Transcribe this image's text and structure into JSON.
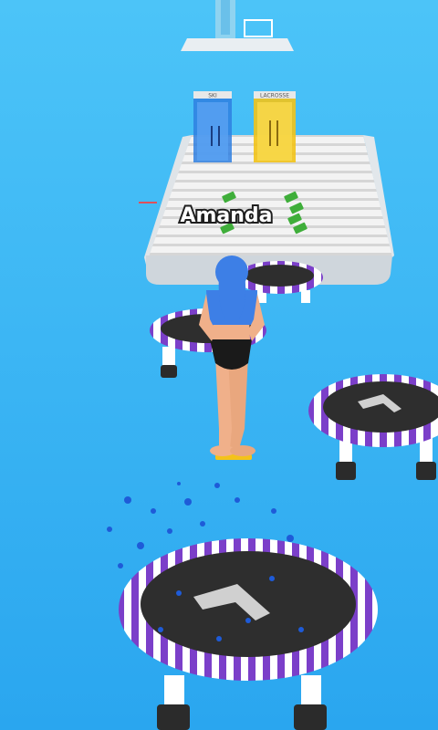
{
  "game": {
    "player_name": "Amanda",
    "gates": [
      {
        "label": "SKI",
        "color": "#2f7fe0"
      },
      {
        "label": "LACROSSE",
        "color": "#f2c318"
      }
    ]
  },
  "colors": {
    "water": "#3ab0f2",
    "trampoline_stripe": "#7b3fc9",
    "trampoline_mat": "#2e2e2e",
    "hair": "#3d7fe6",
    "pogo": "#f4c21a",
    "cash": "#3fae3a"
  }
}
